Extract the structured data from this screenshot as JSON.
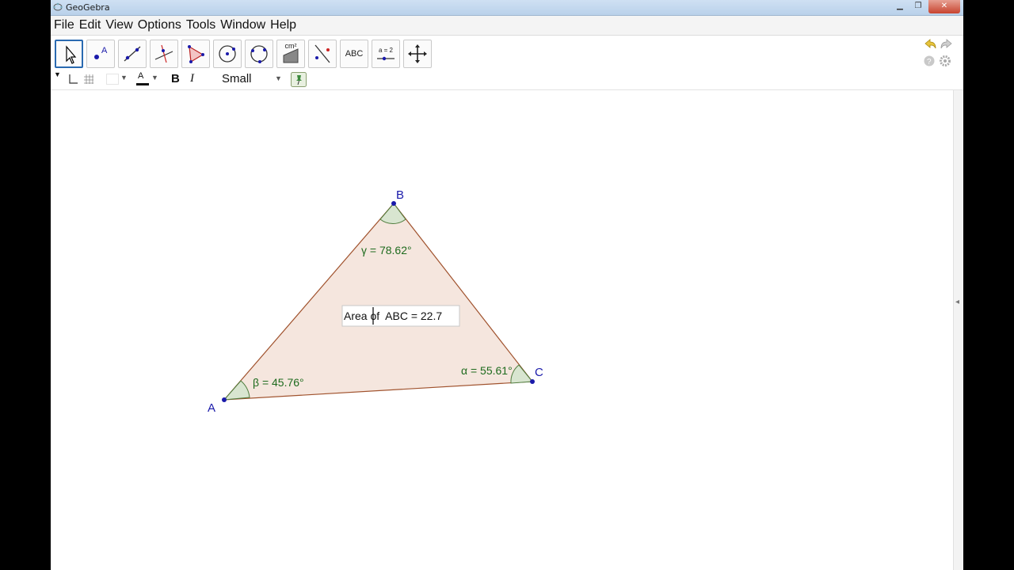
{
  "window": {
    "title": "GeoGebra"
  },
  "menu": [
    "File",
    "Edit",
    "View",
    "Options",
    "Tools",
    "Window",
    "Help"
  ],
  "toolbar": {
    "text_tool_label": "ABC",
    "slider_label": "a = 2",
    "area_label": "cm²"
  },
  "stylebar": {
    "font_size": "Small",
    "bold": "B",
    "italic": "I",
    "color_letter": "A"
  },
  "figure": {
    "points": {
      "A": "A",
      "B": "B",
      "C": "C"
    },
    "angles": {
      "gamma": "γ = 78.62°",
      "beta": "β = 45.76°",
      "alpha": "α = 55.61°"
    },
    "area_text": "Area of  ABC = 22.7"
  },
  "colors": {
    "triangle_fill": "#f5e6de",
    "triangle_edge": "#a0522d",
    "angle_text": "#1e6b1e",
    "point": "#1a1aaa",
    "active_tool": "#2a6ab1"
  }
}
